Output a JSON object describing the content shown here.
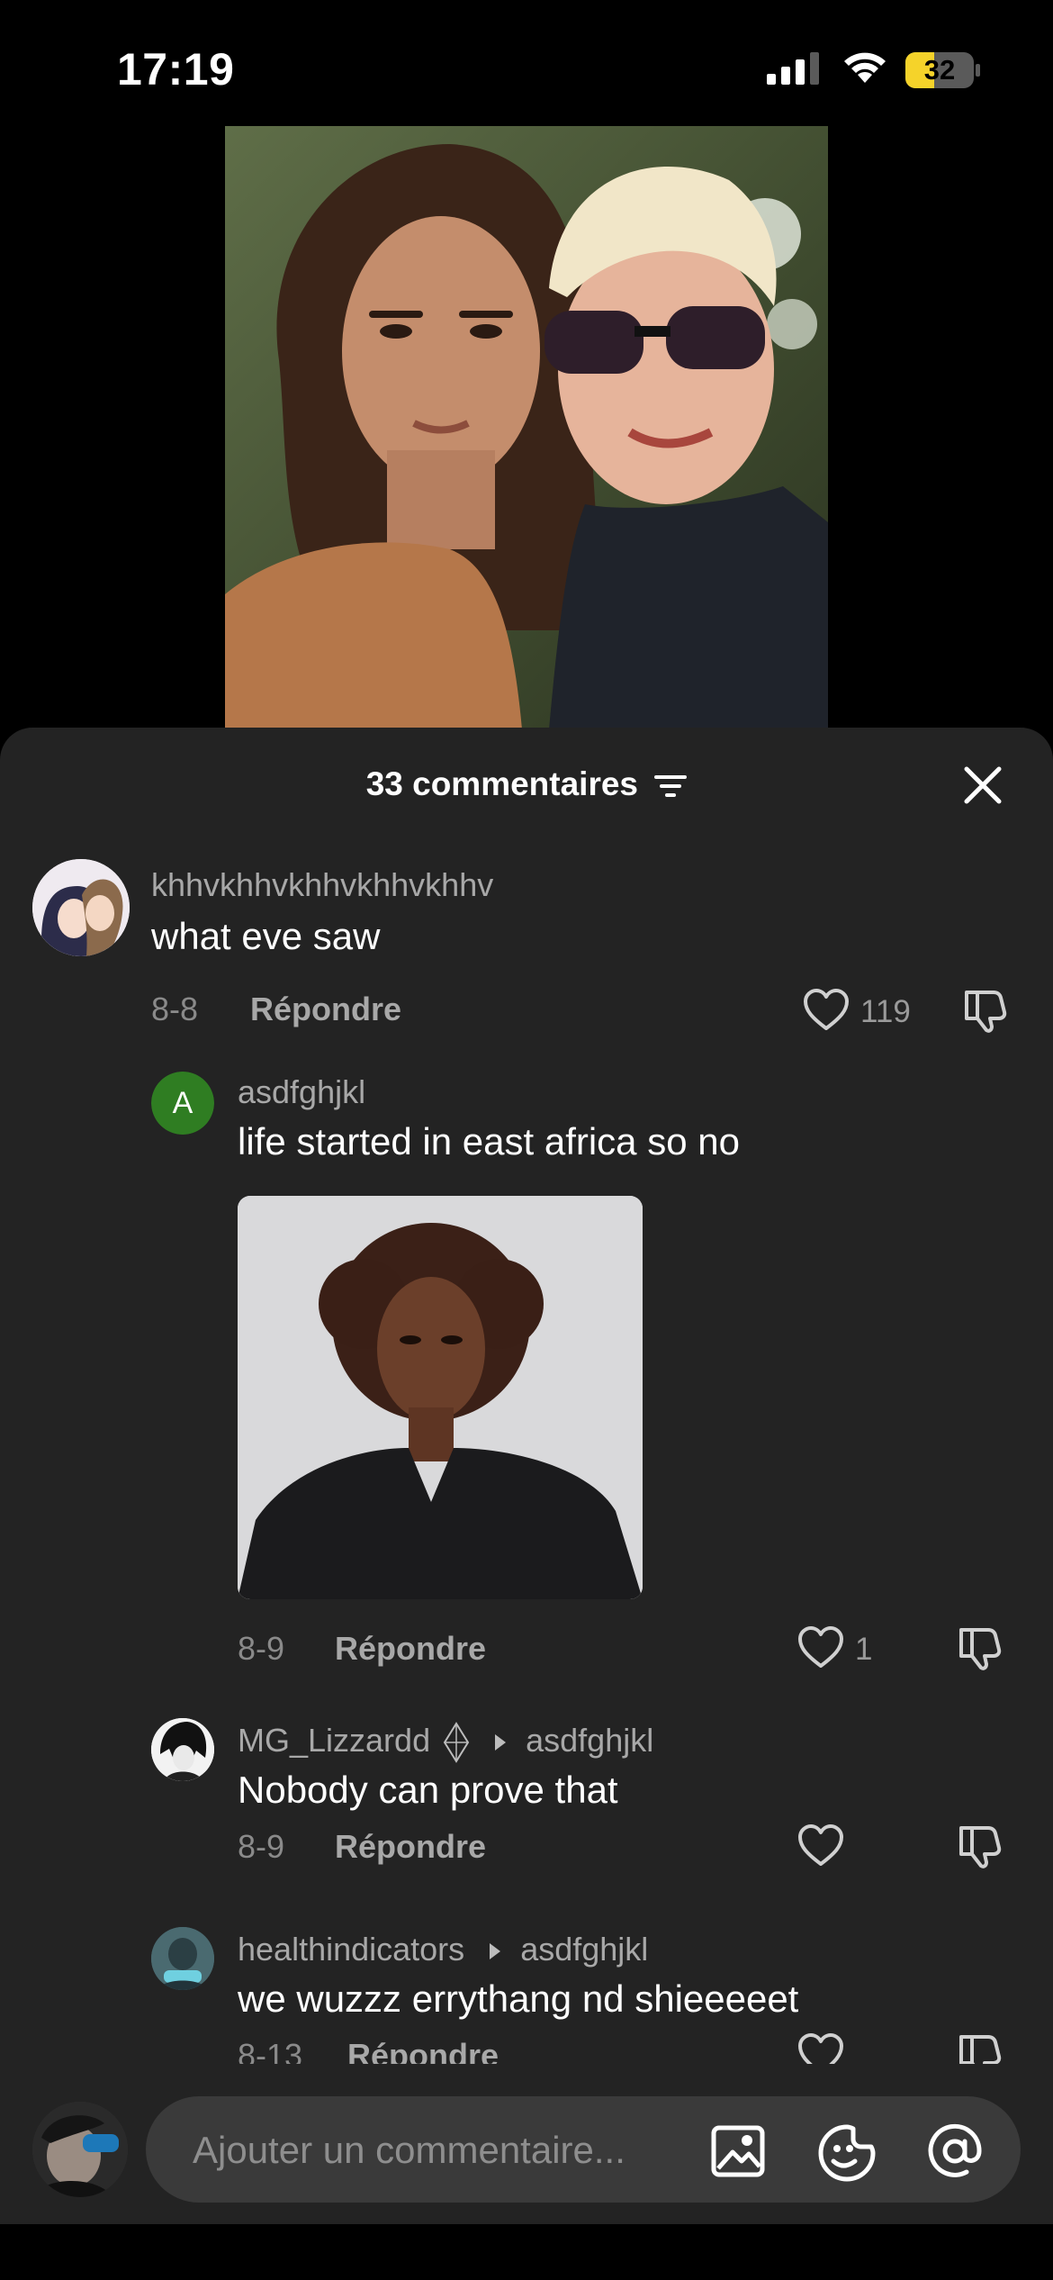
{
  "status_bar": {
    "time": "17:19",
    "battery_level": "32",
    "battery_color": "#f5d32a"
  },
  "sheet": {
    "title": "33 commentaires",
    "close_icon": "close-icon",
    "sort_icon": "sort-icon"
  },
  "comments": [
    {
      "username": "khhvkhhvkhhvkhhvkhhv",
      "text": "what eve saw",
      "date": "8-8",
      "reply_label": "Répondre",
      "likes": "119"
    },
    {
      "avatar_letter": "A",
      "avatar_color": "#2f7d22",
      "username": "asdfghjkl",
      "text": "life started in east africa so no",
      "date": "8-9",
      "reply_label": "Répondre",
      "likes": "1"
    },
    {
      "username": "MG_Lizzardd",
      "reply_to": "asdfghjkl",
      "text": "Nobody can prove that",
      "date": "8-9",
      "reply_label": "Répondre"
    },
    {
      "username": "healthindicators",
      "reply_to": "asdfghjkl",
      "text": "we wuzzz errythang nd shieeeeet",
      "date": "8-13",
      "reply_label": "Répondre"
    }
  ],
  "input": {
    "placeholder": "Ajouter un commentaire..."
  }
}
